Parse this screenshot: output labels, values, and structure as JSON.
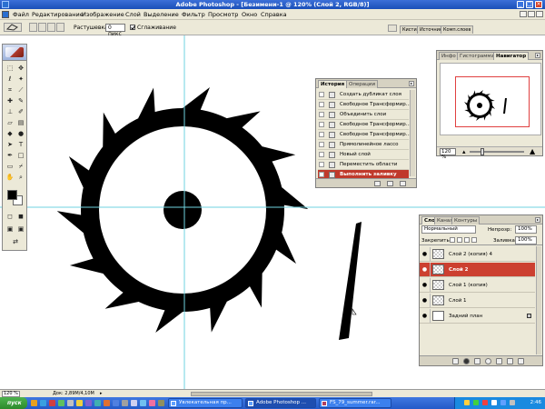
{
  "window": {
    "title": "Adobe Photoshop - [Безимени-1 @ 120% (Слой 2, RGB/8)]",
    "controls": {
      "minimize": "_",
      "maximize": "□",
      "close": "×"
    }
  },
  "menu": {
    "items": [
      "Файл",
      "Редактирование",
      "Изображение",
      "Слой",
      "Выделение",
      "Фильтр",
      "Просмотр",
      "Окно",
      "Справка"
    ]
  },
  "options_bar": {
    "feather_label": "Растушевка:",
    "feather_value": "0 пикс",
    "antialias_label": "Сглаживание",
    "palette_well_tabs": [
      "Кисти",
      "Источник",
      "Комп.слоев"
    ]
  },
  "toolbox": {
    "tool_icons": [
      "marquee-icon",
      "move-icon",
      "lasso-icon",
      "magic-wand-icon",
      "crop-icon",
      "slice-icon",
      "healing-icon",
      "brush-icon",
      "stamp-icon",
      "history-brush-icon",
      "eraser-icon",
      "gradient-icon",
      "blur-icon",
      "dodge-icon",
      "path-select-icon",
      "type-icon",
      "pen-icon",
      "shape-icon",
      "notes-icon",
      "eyedropper-icon",
      "hand-icon",
      "zoom-icon"
    ],
    "foreground_color": "#000000",
    "background_color": "#ffffff"
  },
  "history_panel": {
    "tabs": [
      "История",
      "Операции"
    ],
    "items": [
      "Создать дубликат слоя",
      "Свободное Трансформир...",
      "Объединить слои",
      "Свободное Трансформир...",
      "Свободное Трансформир...",
      "Прямолинейное лассо",
      "Новый слой",
      "Переместить области",
      "Выполнить заливку"
    ],
    "selected_index": 8
  },
  "navigator_panel": {
    "tabs": [
      "Инфо",
      "Гистограмма",
      "Навигатор"
    ],
    "zoom": "120 %"
  },
  "layers_panel": {
    "tabs": [
      "Слои",
      "Каналы",
      "Контуры"
    ],
    "blend_mode": "Нормальный",
    "opacity_label": "Непрозр:",
    "opacity_value": "100%",
    "lock_label": "Закрепить:",
    "fill_label": "Заливка:",
    "fill_value": "100%",
    "layers": [
      {
        "name": "Слой 2 (копия) 4",
        "selected": false,
        "thumb": "transparent",
        "locked": false
      },
      {
        "name": "Слой 2",
        "selected": true,
        "thumb": "transparent",
        "locked": false
      },
      {
        "name": "Слой 1 (копия)",
        "selected": false,
        "thumb": "transparent",
        "locked": false
      },
      {
        "name": "Слой 1",
        "selected": false,
        "thumb": "transparent",
        "locked": false
      },
      {
        "name": "Задний план",
        "selected": false,
        "thumb": "white",
        "locked": true
      }
    ]
  },
  "status_bar": {
    "zoom": "120 %",
    "doc_info": "Док: 2,89M/4,10M"
  },
  "taskbar": {
    "start_label": "пуск",
    "tasks": [
      "Увлекательная пр...",
      "Adobe Photoshop ...",
      "FS_79_summer.rar..."
    ],
    "active_task_index": 1,
    "clock": "2:46"
  },
  "colors": {
    "selection_red": "#cc4030",
    "guide_cyan": "#6fd3e0",
    "panel_bg": "#ece9d8"
  }
}
